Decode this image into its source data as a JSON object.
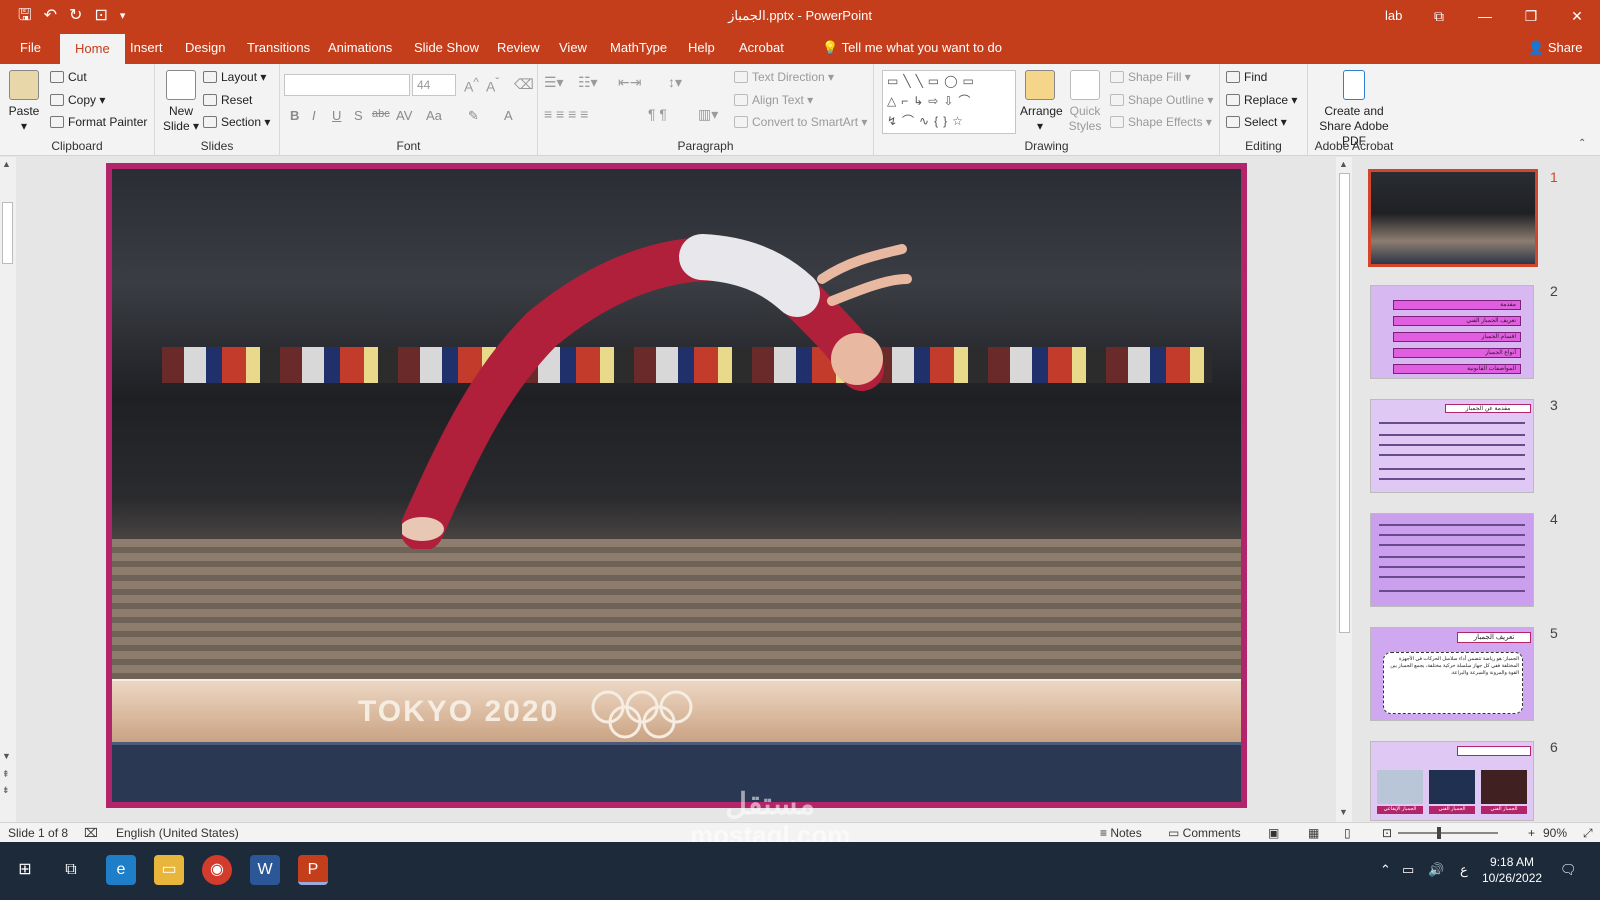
{
  "window": {
    "title": "الجمباز.pptx - PowerPoint",
    "user": "lab",
    "controls": [
      "⧉",
      "—",
      "❐",
      "✕"
    ]
  },
  "qat": {
    "save": "🖫",
    "undo": "↶",
    "redo": "↻",
    "present": "⊡",
    "more": "▾"
  },
  "tabs": [
    "File",
    "Home",
    "Insert",
    "Design",
    "Transitions",
    "Animations",
    "Slide Show",
    "Review",
    "View",
    "MathType",
    "Help",
    "Acrobat"
  ],
  "tell_me": "Tell me what you want to do",
  "share": "Share",
  "ribbon": {
    "clipboard": {
      "paste": "Paste",
      "cut": "Cut",
      "copy": "Copy",
      "format_painter": "Format Painter",
      "label": "Clipboard"
    },
    "slides": {
      "new_slide": "New Slide",
      "layout": "Layout",
      "reset": "Reset",
      "section": "Section",
      "label": "Slides"
    },
    "font": {
      "size": "44",
      "bold": "B",
      "italic": "I",
      "underline": "U",
      "shadow": "S",
      "strike": "abc",
      "spacing": "AV",
      "case": "Aa",
      "label": "Font"
    },
    "paragraph": {
      "text_direction": "Text Direction",
      "align_text": "Align Text",
      "convert_smartart": "Convert to SmartArt",
      "label": "Paragraph"
    },
    "drawing": {
      "arrange": "Arrange",
      "quick_styles": "Quick Styles",
      "shape_fill": "Shape Fill",
      "shape_outline": "Shape Outline",
      "shape_effects": "Shape Effects",
      "label": "Drawing"
    },
    "editing": {
      "find": "Find",
      "replace": "Replace",
      "select": "Select",
      "label": "Editing"
    },
    "acrobat": {
      "create_share": "Create and Share Adobe PDF",
      "label": "Adobe Acrobat"
    }
  },
  "slide": {
    "beam_text": "TOKYO 2020"
  },
  "thumbnails": {
    "numbers": [
      "1",
      "2",
      "3",
      "4",
      "5",
      "6"
    ],
    "slide2_items": [
      "مقدمة",
      "تعريف الجمباز الفني",
      "اقسام الجمباز",
      "أنواع الجمباز",
      "المواصفات القانونية"
    ],
    "slide3_title": "مقدمة عن الجمباز",
    "slide5_title": "تعريف الجمباز",
    "slide5_body": "الجمباز: هو رياضة تتضمن أداء سلاسل الحركات في الأجهزة المختلفة ففي كل جهاز سلسلة حركية مختلفة، يجمع الجمباز بين القوة والمرونة والسرعة والبراعة.",
    "slide6_labels": [
      "الجمباز الإيقاعي",
      "الجمباز الفني",
      "الجمباز الفني"
    ]
  },
  "status": {
    "slide_info": "Slide 1 of 8",
    "language": "English (United States)",
    "notes": "Notes",
    "comments": "Comments",
    "zoom": "90%"
  },
  "taskbar": {
    "time": "9:18 AM",
    "date": "10/26/2022",
    "lang": "ع"
  },
  "watermark": {
    "ar": "مستقل",
    "en": "mostaql.com"
  }
}
